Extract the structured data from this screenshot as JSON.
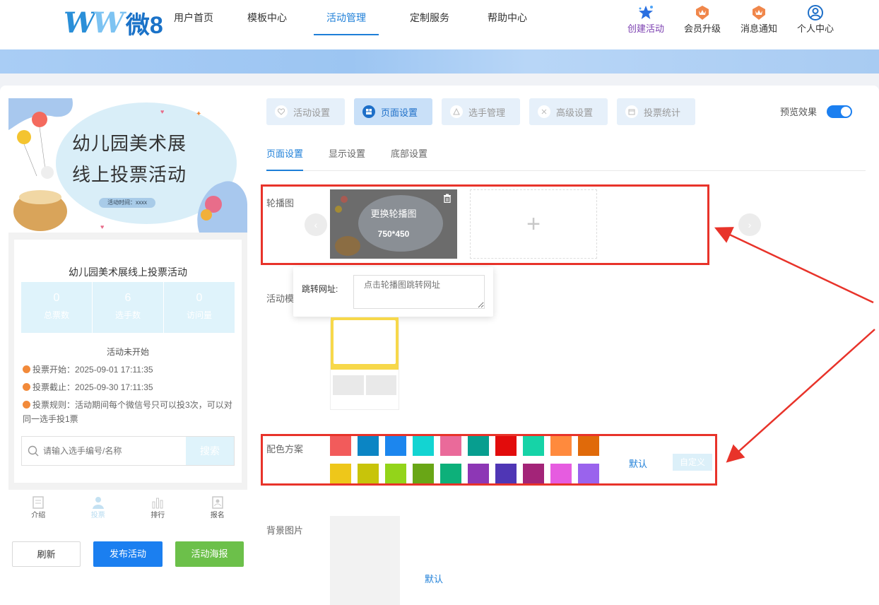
{
  "logo": {
    "mark": "W",
    "text": "微8"
  },
  "nav": {
    "items": [
      "用户首页",
      "模板中心",
      "活动管理",
      "定制服务",
      "帮助中心"
    ],
    "active_index": 2,
    "right": [
      {
        "label": "创建活动",
        "icon": "star-icon"
      },
      {
        "label": "会员升级",
        "icon": "crown-badge-icon"
      },
      {
        "label": "消息通知",
        "icon": "crown-badge-icon"
      },
      {
        "label": "个人中心",
        "icon": "user-circle-icon"
      }
    ]
  },
  "phone": {
    "hero_line1": "幼儿园美术展",
    "hero_line2": "线上投票活动",
    "hero_time": "活动时间：xxxx",
    "card_title": "幼儿园美术展线上投票活动",
    "stats": [
      {
        "num": "0",
        "label": "总票数"
      },
      {
        "num": "6",
        "label": "选手数"
      },
      {
        "num": "0",
        "label": "访问量"
      }
    ],
    "status": "活动未开始",
    "info": [
      {
        "label": "投票开始：",
        "value": "2025-09-01 17:11:35"
      },
      {
        "label": "投票截止：",
        "value": "2025-09-30 17:11:35"
      },
      {
        "label": "投票规则：",
        "value": "活动期间每个微信号只可以投3次，可以对同一选手投1票"
      }
    ],
    "search_placeholder": "请输入选手编号/名称",
    "search_button": "搜索",
    "tabbar": [
      "介绍",
      "投票",
      "排行",
      "报名"
    ]
  },
  "actions": {
    "refresh": "刷新",
    "publish": "发布活动",
    "poster": "活动海报"
  },
  "main_tabs": [
    "活动设置",
    "页面设置",
    "选手管理",
    "高级设置",
    "投票统计"
  ],
  "main_tab_active": 1,
  "preview": {
    "label": "预览效果",
    "enabled": true
  },
  "sub_tabs": [
    "页面设置",
    "显示设置",
    "底部设置"
  ],
  "sub_tab_active": 0,
  "carousel": {
    "label": "轮播图",
    "change_text": "更换轮播图",
    "size_text": "750*450",
    "add_symbol": "+"
  },
  "jump": {
    "label": "跳转网址:",
    "placeholder": "点击轮播图跳转网址"
  },
  "template_label": "活动模",
  "color_scheme": {
    "label": "配色方案",
    "row1": [
      "#f25b5b",
      "#0b85c4",
      "#1c86ee",
      "#13d4d2",
      "#ea6a9a",
      "#079e8f",
      "#e20c0c",
      "#16d3a7",
      "#ff8a3d",
      "#e06a0a"
    ],
    "row2": [
      "#eec71a",
      "#c8c40a",
      "#93d41a",
      "#69a616",
      "#0db07a",
      "#8d37b5",
      "#4f36b5",
      "#a32478",
      "#e65ce0",
      "#9a63ed"
    ],
    "default_label": "默认",
    "custom_label": "自定义"
  },
  "background": {
    "label": "背景图片",
    "default_label": "默认"
  },
  "colors": {
    "accent": "#1e7fd8",
    "highlight": "#e8332a"
  }
}
